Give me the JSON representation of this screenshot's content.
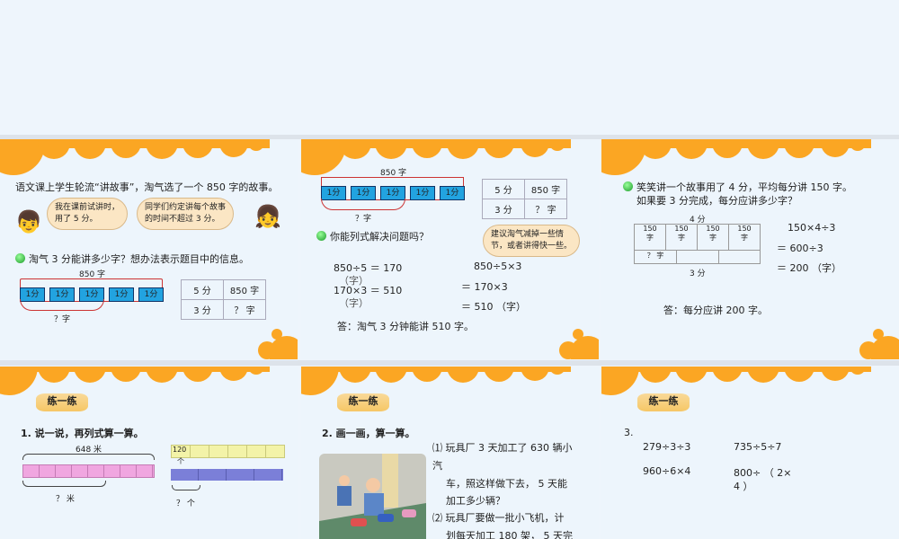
{
  "slide1": {
    "intro": "语文课上学生轮流“讲故事”，淘气选了一个 850 字的故事。",
    "bubble_left": [
      "我在课前试讲时，",
      "用了 5 分。"
    ],
    "bubble_right": [
      "同学们约定讲每个故事",
      "的时间不超过 3 分。"
    ],
    "question": "淘气 3 分能讲多少字？想办法表示题目中的信息。",
    "total": "850 字",
    "unit": "1分",
    "unknown": "？字",
    "table": [
      [
        "5 分",
        "850 字"
      ],
      [
        "3 分",
        "？ 字"
      ]
    ]
  },
  "slide2": {
    "total": "850 字",
    "unit": "1分",
    "unknown": "？字",
    "table": [
      [
        "5 分",
        "850 字"
      ],
      [
        "3 分",
        "？ 字"
      ]
    ],
    "bubble": [
      "建议淘气减掉一些情",
      "节，或者讲得快一些。"
    ],
    "question": "你能列式解决问题吗？",
    "left_calc": [
      "850÷5 ＝ 170",
      "（字）",
      "170×3 ＝ 510",
      "（字）"
    ],
    "right_calc": [
      "850÷5×3",
      "＝ 170×3",
      "＝ 510 （字）"
    ],
    "answer": "答：淘气 3 分钟能讲 510 字。"
  },
  "slide3": {
    "question_1": "笑笑讲一个故事用了 4 分，平均每分讲 150 字。",
    "question_2": "如果要 3 分完成，每分应讲多少字？",
    "top_label": "4 分",
    "bottom_label": "3 分",
    "cell": "150",
    "cell_unit": "字",
    "unknown": "？ 字",
    "calc": [
      "150×4÷3",
      "＝ 600÷3",
      "＝ 200 （字）"
    ],
    "answer": "答：每分应讲 200 字。"
  },
  "slide4": {
    "badge": "练一练",
    "title": "1. 说一说，再列式算一算。",
    "total": "648 米",
    "unknown_left": "？ 米",
    "yellow_value": "120",
    "yellow_unit": "个",
    "unknown_right": "？ 个"
  },
  "slide5": {
    "badge": "练一练",
    "title": "2. 画一画，算一算。",
    "q1": [
      "⑴ 玩具厂 3 天加工了 630 辆小",
      "汽",
      "车，照这样做下去， 5 天能",
      "加工多少辆？"
    ],
    "q2": [
      "⑵ 玩具厂要做一批小飞机，计",
      "划每天加工 180 架， 5 天完"
    ]
  },
  "slide6": {
    "badge": "练一练",
    "num": "3.",
    "exprs": [
      "279÷3÷3",
      "735÷5÷7",
      "960÷6×4",
      "800÷ （ 2×",
      "4 ）"
    ]
  },
  "colors": {
    "orange": "#fba623",
    "blue_seg": "#22a3e0",
    "pink": "#f0a6e0",
    "yellow": "#f3f3a8",
    "purple": "#7b7fd8"
  }
}
